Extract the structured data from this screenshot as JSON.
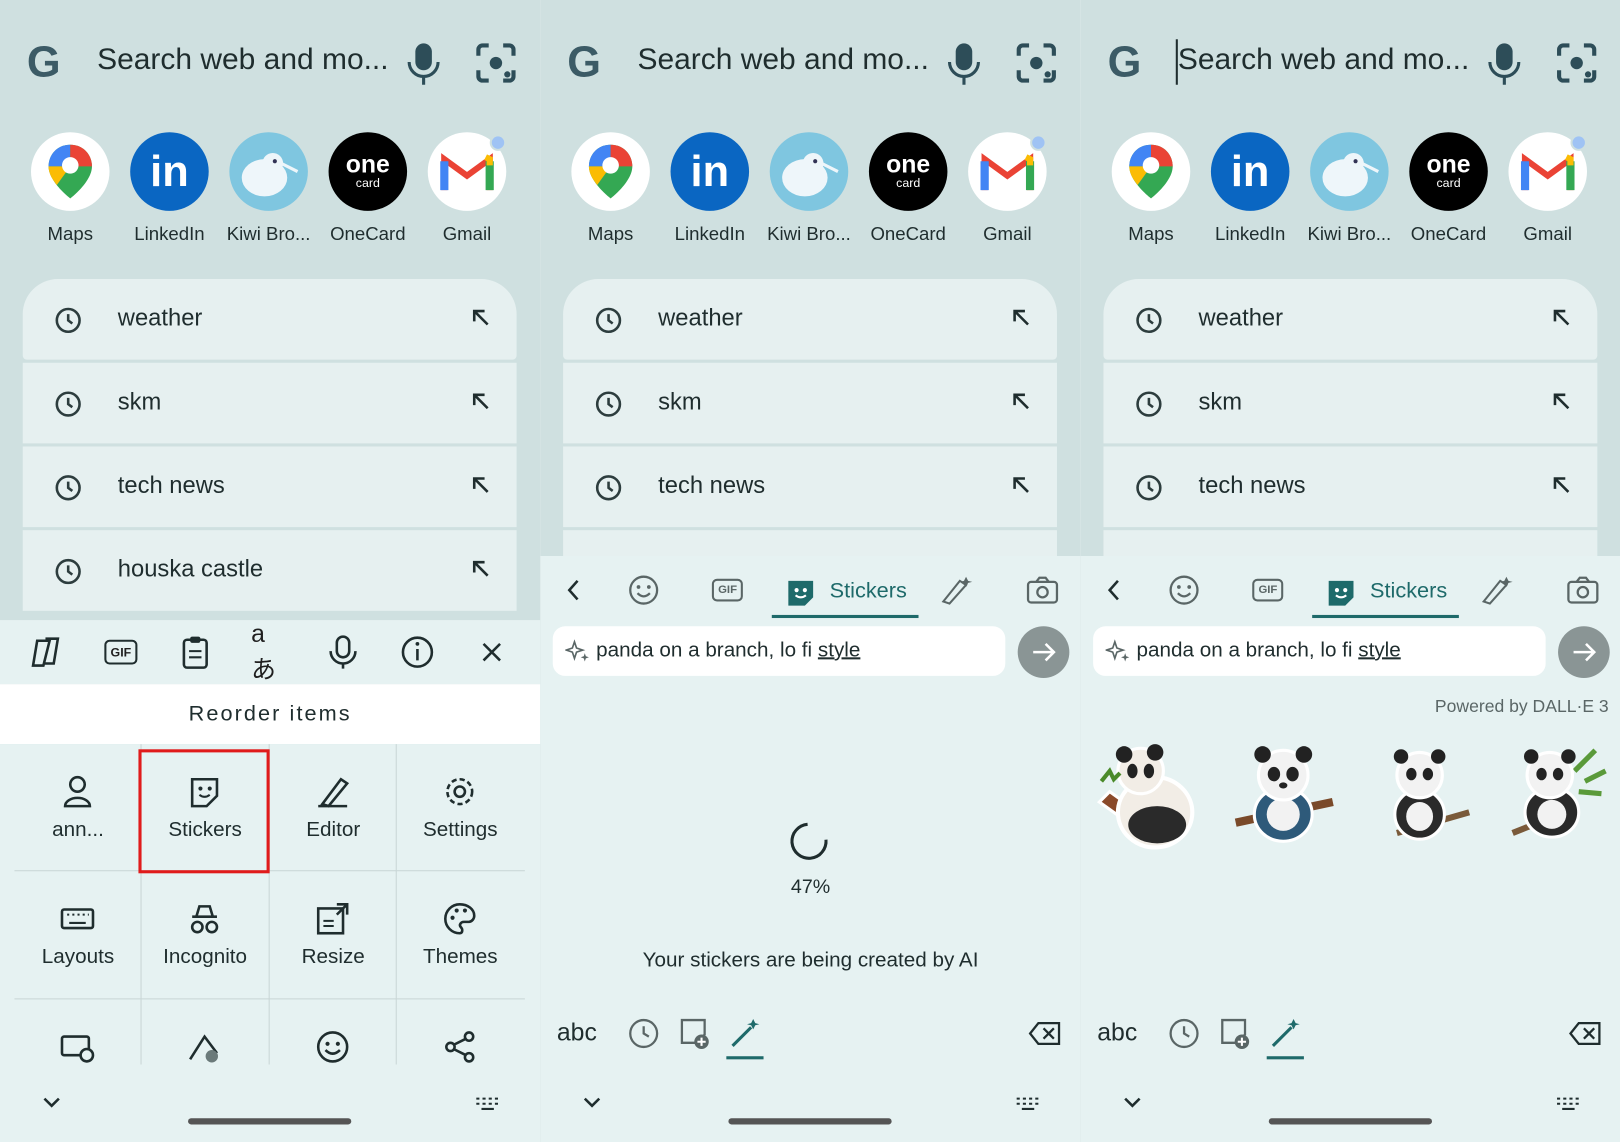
{
  "search": {
    "placeholder": "Search web and mo..."
  },
  "apps": [
    {
      "label": "Maps"
    },
    {
      "label": "LinkedIn"
    },
    {
      "label": "Kiwi Bro..."
    },
    {
      "label": "OneCard"
    },
    {
      "label": "Gmail"
    }
  ],
  "app_glyphs": {
    "linkedin": "in",
    "onecard_top": "one",
    "onecard_bottom": "card",
    "google": "G"
  },
  "history": [
    "weather",
    "skm",
    "tech news",
    "houska castle"
  ],
  "keyboard_menu": {
    "title": "Reorder items",
    "items": [
      {
        "label": "ann...",
        "icon": "person-icon"
      },
      {
        "label": "Stickers",
        "icon": "sticker-icon"
      },
      {
        "label": "Editor",
        "icon": "editor-icon"
      },
      {
        "label": "Settings",
        "icon": "gear-icon"
      },
      {
        "label": "Layouts",
        "icon": "keyboard-icon"
      },
      {
        "label": "Incognito",
        "icon": "incognito-icon"
      },
      {
        "label": "Resize",
        "icon": "resize-icon"
      },
      {
        "label": "Themes",
        "icon": "palette-icon"
      }
    ],
    "toolbar_gif": "GIF"
  },
  "stickers": {
    "tab_label": "Stickers",
    "gif_label": "GIF",
    "prompt": "panda on a branch, lo fi ",
    "prompt_underlined": "style",
    "progress": "47%",
    "progress_value": 47,
    "loading_message": "Your stickers are being created by AI",
    "powered_by": "Powered by DALL·E 3",
    "abc_label": "abc"
  },
  "colors": {
    "panel_bg": "#cfe0e0",
    "keyboard_bg": "#e6f2f2",
    "accent": "#1e6a6a",
    "highlight_border": "#e01b1b"
  }
}
